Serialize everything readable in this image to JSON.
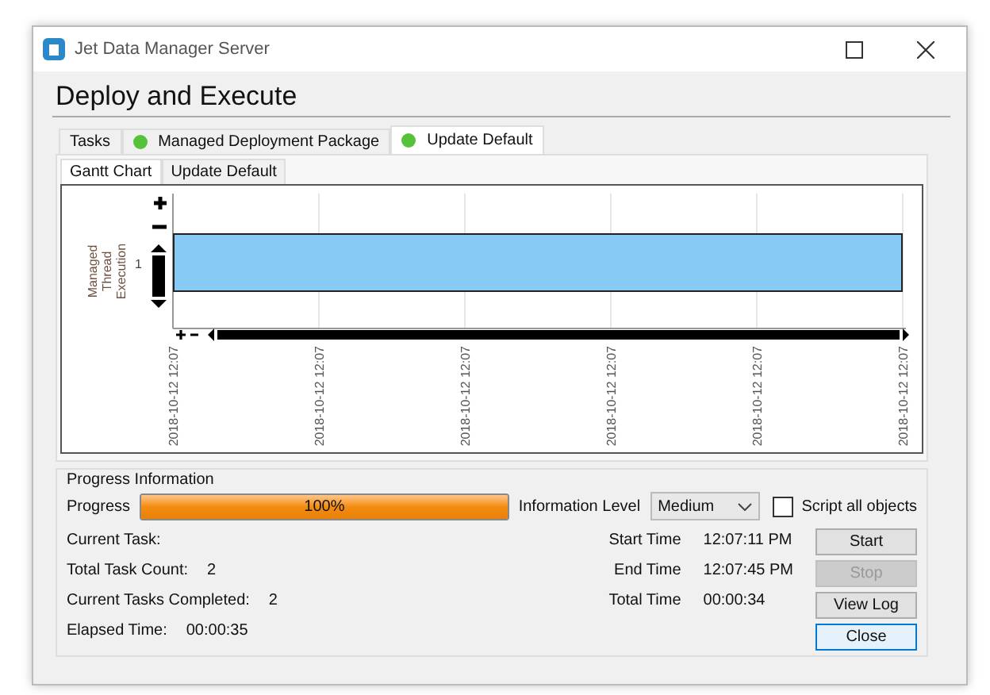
{
  "window": {
    "title": "Jet Data Manager Server"
  },
  "heading": "Deploy and Execute",
  "tabs": [
    {
      "label": "Tasks",
      "status": false,
      "selected": false
    },
    {
      "label": "Managed Deployment Package",
      "status": true,
      "selected": false
    },
    {
      "label": "Update Default",
      "status": true,
      "selected": true
    }
  ],
  "subtabs": [
    {
      "label": "Gantt Chart",
      "selected": true
    },
    {
      "label": "Update Default",
      "selected": false
    }
  ],
  "gantt": {
    "y_title": [
      "Managed",
      "Thread",
      "Execution"
    ],
    "y_tick": "1",
    "x_ticks": [
      "2018-10-12 12:07",
      "2018-10-12 12:07",
      "2018-10-12 12:07",
      "2018-10-12 12:07",
      "2018-10-12 12:07",
      "2018-10-12 12:07"
    ]
  },
  "progress": {
    "group_title": "Progress Information",
    "label": "Progress",
    "level": 1,
    "reading": "100%",
    "info_level_label": "Information Level",
    "info_level": "Medium",
    "script_all": {
      "label": "Script all objects",
      "checked": false
    }
  },
  "stats": [
    {
      "label": "Current Task:"
    },
    {
      "label": "Total Task Count:",
      "value": "2"
    },
    {
      "label": "Current Tasks Completed:",
      "value": "2"
    },
    {
      "label": "Elapsed Time:",
      "value": "00:00:35"
    }
  ],
  "times": [
    {
      "label": "Start Time",
      "value": "12:07:11 PM"
    },
    {
      "label": "End Time",
      "value": "12:07:45 PM"
    },
    {
      "label": "Total Time",
      "value": "00:00:34"
    }
  ],
  "buttons": [
    {
      "label": "Start",
      "disabled": false,
      "focused": false
    },
    {
      "label": "Stop",
      "disabled": true,
      "focused": false
    },
    {
      "label": "View Log",
      "disabled": false,
      "focused": false
    },
    {
      "label": "Close",
      "disabled": false,
      "focused": true
    }
  ]
}
